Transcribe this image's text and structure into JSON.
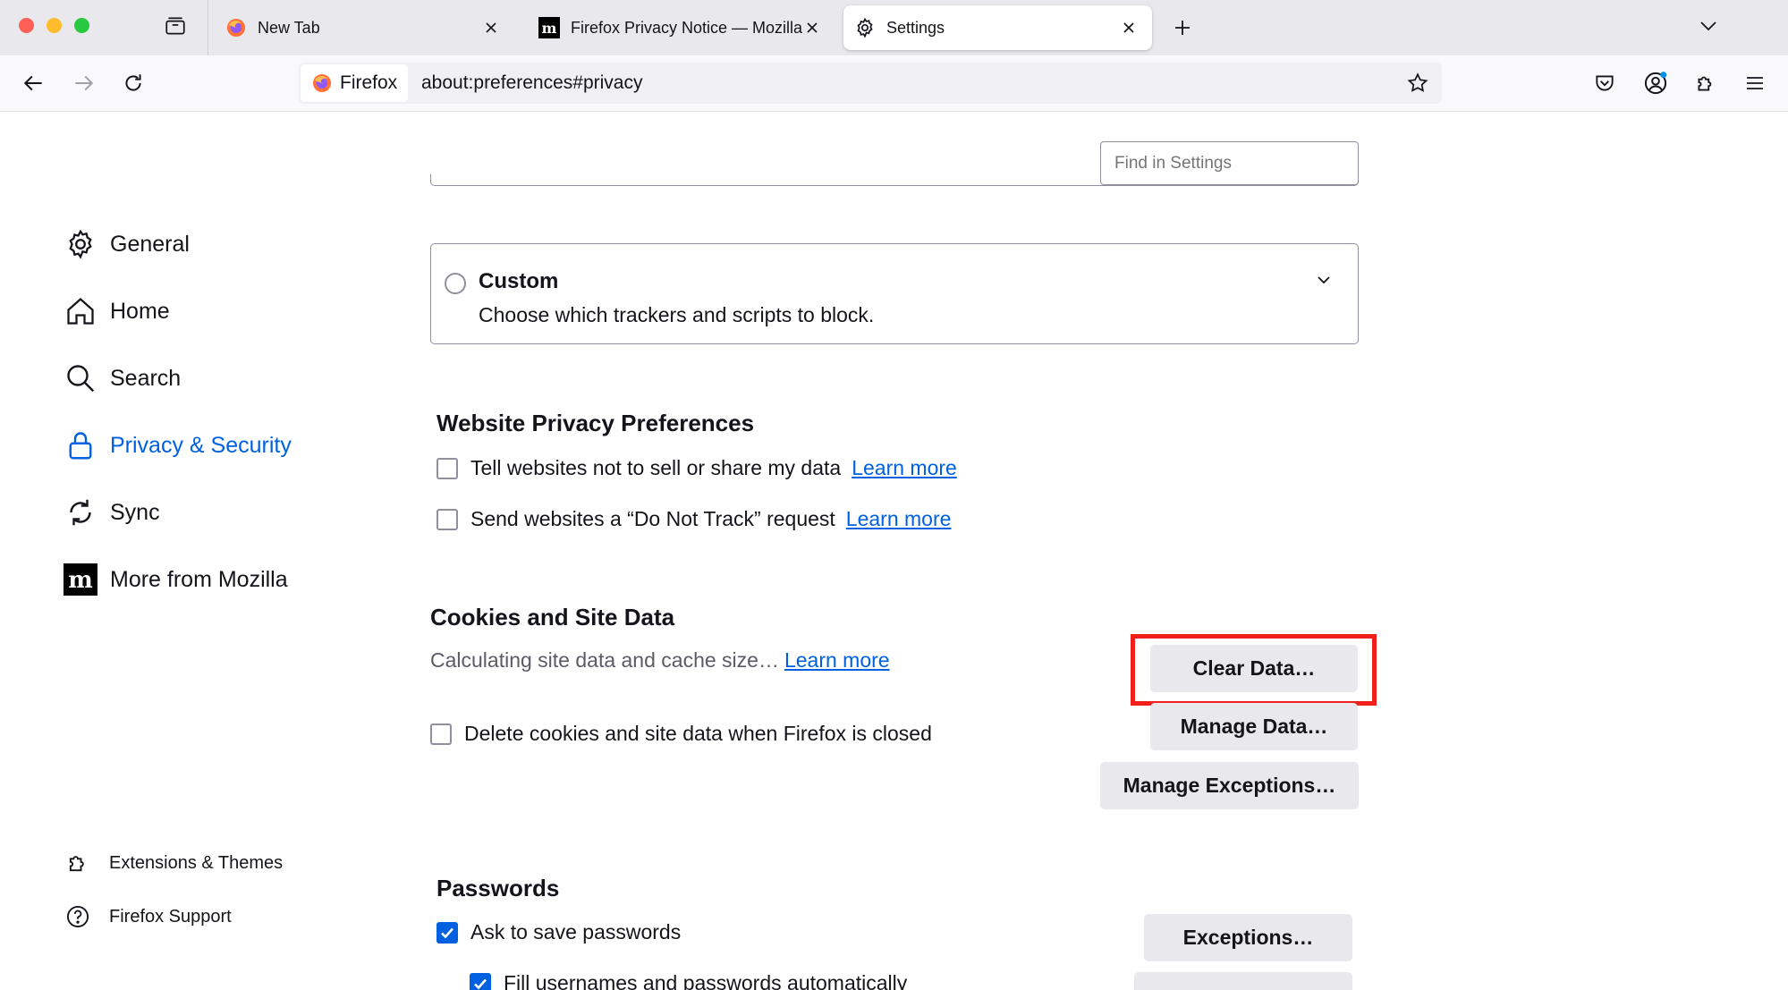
{
  "window": {
    "traffic_colors": {
      "close": "#fe5f57",
      "minimize": "#febc2e",
      "zoom": "#28c840"
    }
  },
  "tabs": [
    {
      "title": "New Tab",
      "favicon": "firefox-icon",
      "active": false
    },
    {
      "title": "Firefox Privacy Notice — Mozilla",
      "favicon": "mozilla-m-icon",
      "active": false
    },
    {
      "title": "Settings",
      "favicon": "gear-icon",
      "active": true
    }
  ],
  "navbar": {
    "identity_label": "Firefox",
    "url": "about:preferences#privacy"
  },
  "search": {
    "placeholder": "Find in Settings"
  },
  "sidebar": {
    "items": [
      {
        "label": "General",
        "icon": "gear-icon"
      },
      {
        "label": "Home",
        "icon": "home-icon"
      },
      {
        "label": "Search",
        "icon": "search-icon"
      },
      {
        "label": "Privacy & Security",
        "icon": "lock-icon",
        "active": true
      },
      {
        "label": "Sync",
        "icon": "sync-icon"
      },
      {
        "label": "More from Mozilla",
        "icon": "mozilla-m-icon"
      }
    ],
    "footer": [
      {
        "label": "Extensions & Themes",
        "icon": "puzzle-icon"
      },
      {
        "label": "Firefox Support",
        "icon": "help-icon"
      }
    ]
  },
  "tracking": {
    "custom_title": "Custom",
    "custom_desc": "Choose which trackers and scripts to block."
  },
  "privacy_prefs": {
    "title": "Website Privacy Preferences",
    "items": [
      {
        "label": "Tell websites not to sell or share my data",
        "link": "Learn more",
        "checked": false
      },
      {
        "label": "Send websites a “Do Not Track” request",
        "link": "Learn more",
        "checked": false
      }
    ]
  },
  "cookies": {
    "title": "Cookies and Site Data",
    "status": "Calculating site data and cache size…",
    "link": "Learn more",
    "delete_label": "Delete cookies and site data when Firefox is closed",
    "delete_checked": false,
    "buttons": {
      "clear": "Clear Data…",
      "manage": "Manage Data…",
      "exceptions": "Manage Exceptions…"
    }
  },
  "passwords": {
    "title": "Passwords",
    "ask_label": "Ask to save passwords",
    "ask_checked": true,
    "fill_label": "Fill usernames and passwords automatically",
    "fill_checked": true,
    "exceptions_button": "Exceptions…"
  },
  "colors": {
    "accent": "#0061e0",
    "highlight": "#f0201c"
  }
}
